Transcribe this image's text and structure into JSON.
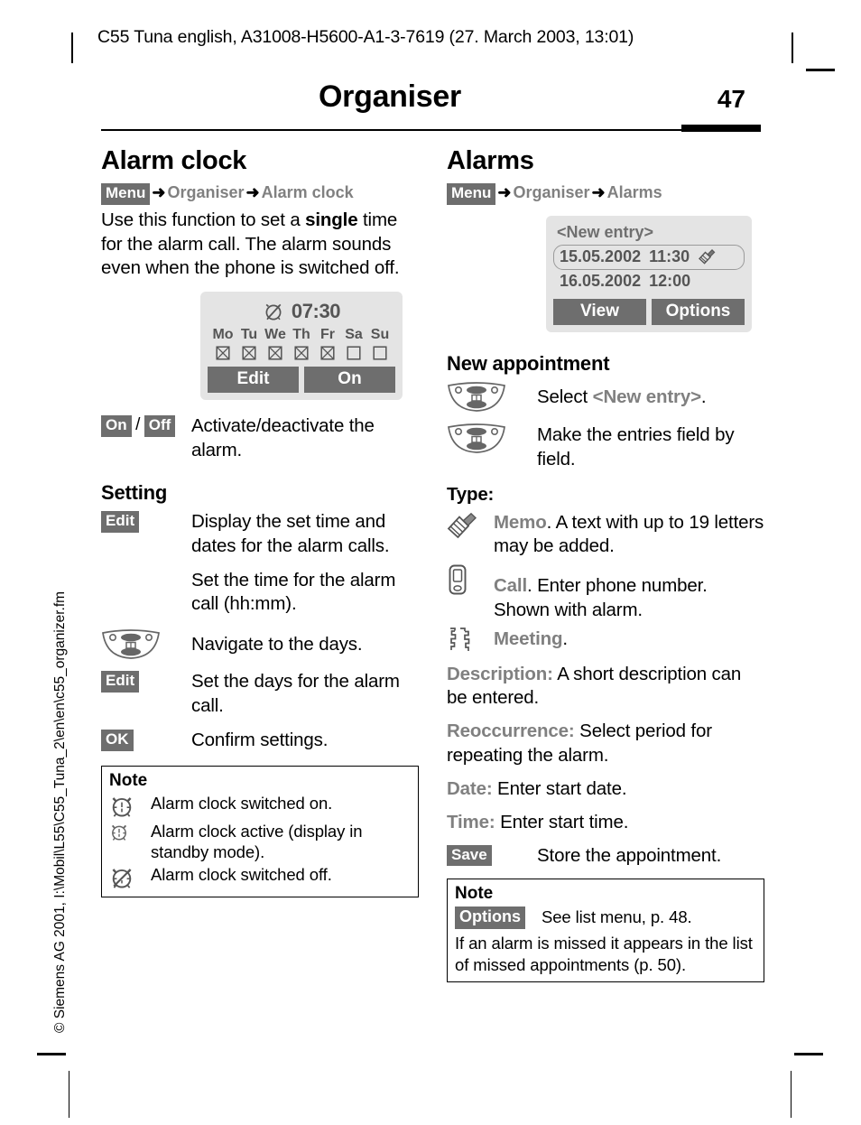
{
  "runhead": "C55 Tuna english, A31008-H5600-A1-3-7619 (27. March 2003, 13:01)",
  "chapter_title": "Organiser",
  "page_number": "47",
  "side_credit": "© Siemens AG 2001, I:\\Mobil\\L55\\C55_Tuna_2\\en\\en\\c55_organizer.fm",
  "left_column": {
    "heading": "Alarm clock",
    "breadcrumb": {
      "key": "Menu",
      "arrow": "➜",
      "item1": "Organiser",
      "item2": "Alarm clock"
    },
    "intro_before": "Use this function to set a ",
    "intro_strong": "single",
    "intro_after": " time for the alarm call. The alarm sounds even when the phone is switched off.",
    "alarm_screen": {
      "time": "07:30",
      "days": [
        "Mo",
        "Tu",
        "We",
        "Th",
        "Fr",
        "Sa",
        "Su"
      ],
      "checked": [
        true,
        true,
        true,
        true,
        true,
        false,
        false
      ],
      "softkey_left": "Edit",
      "softkey_right": "On"
    },
    "onoff_row": {
      "key_on": "On",
      "separator": "/",
      "key_off": "Off",
      "text": "Activate/deactivate the alarm."
    },
    "setting_heading": "Setting",
    "setting_rows": [
      {
        "key": "Edit",
        "icon": "",
        "text": "Display the set time and dates for the alarm calls."
      },
      {
        "key": "",
        "icon": "",
        "text": "Set the time for the alarm call (hh:mm)."
      },
      {
        "key": "",
        "icon": "nav-key-icon",
        "text": "Navigate to the days."
      },
      {
        "key": "Edit",
        "icon": "",
        "text": "Set the days for the alarm call."
      },
      {
        "key": "OK",
        "icon": "",
        "text": "Confirm settings."
      }
    ],
    "note": {
      "title": "Note",
      "rows": [
        {
          "icon": "alarm-clock-on-icon",
          "text": "Alarm clock switched on."
        },
        {
          "icon": "alarm-clock-active-icon",
          "text": "Alarm clock active (display in standby mode)."
        },
        {
          "icon": "alarm-clock-off-icon",
          "text": "Alarm clock switched off."
        }
      ]
    }
  },
  "right_column": {
    "heading": "Alarms",
    "breadcrumb": {
      "key": "Menu",
      "arrow": "➜",
      "item1": "Organiser",
      "item2": "Alarms"
    },
    "alarms_screen": {
      "new_entry": "<New entry>",
      "entries": [
        {
          "date": "15.05.2002",
          "time": "11:30",
          "icon": "memo-icon",
          "selected": true
        },
        {
          "date": "16.05.2002",
          "time": "12:00",
          "icon": "",
          "selected": false
        }
      ],
      "softkey_left": "View",
      "softkey_right": "Options"
    },
    "new_appointment_heading": "New appointment",
    "nav_rows": [
      {
        "icon": "nav-key-icon",
        "text_before": "Select ",
        "text_grey": "<New entry>",
        "text_after": "."
      },
      {
        "icon": "nav-key-icon",
        "text_before": "Make the entries field by field.",
        "text_grey": "",
        "text_after": ""
      }
    ],
    "type_heading": "Type:",
    "type_rows": [
      {
        "icon": "memo-icon",
        "lead": "Memo",
        "text": ". A text with up to 19 letters may be added."
      },
      {
        "icon": "phone-icon",
        "lead": "Call",
        "text": ". Enter phone number. Shown with alarm."
      },
      {
        "icon": "meeting-icon",
        "lead": "Meeting",
        "text": "."
      }
    ],
    "field_rows": [
      {
        "lead": "Description:",
        "text": " A short description can be entered."
      },
      {
        "lead": "Reoccurrence:",
        "text": " Select period for repeating the alarm."
      },
      {
        "lead": "Date:",
        "text": " Enter start date."
      },
      {
        "lead": "Time:",
        "text": " Enter start time."
      }
    ],
    "save_row": {
      "key": "Save",
      "text": "Store the appointment."
    },
    "note": {
      "title": "Note",
      "key": "Options",
      "key_text": "See list menu, p. 48.",
      "paragraph": "If an alarm is missed it appears in the list of missed appointments (p. 50)."
    }
  }
}
